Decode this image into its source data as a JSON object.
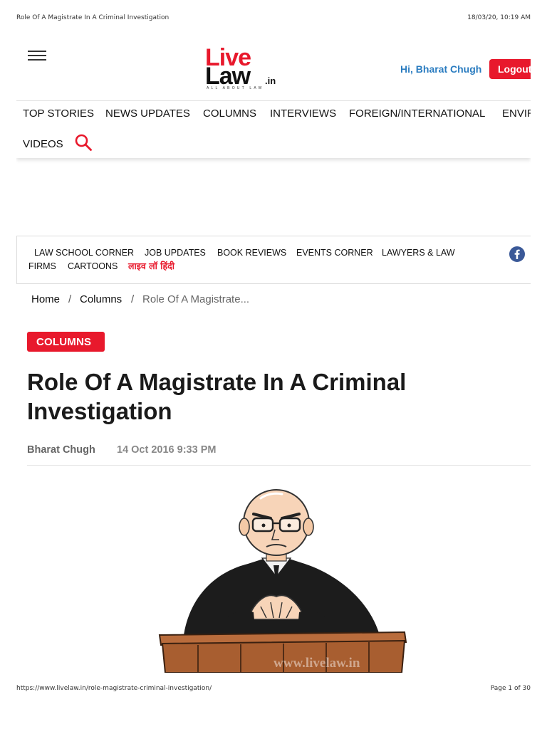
{
  "print": {
    "page_title": "Role Of A Magistrate In A Criminal Investigation",
    "datetime": "18/03/20, 10:19 AM",
    "url": "https://www.livelaw.in/role-magistrate-criminal-investigation/",
    "page_number": "Page 1 of 30"
  },
  "header": {
    "menu_icon": "hamburger-menu-icon",
    "logo": {
      "line1": "Live",
      "line2": "Law",
      "tld": ".in",
      "tagline": "ALL ABOUT LAW"
    },
    "greeting": "Hi, Bharat Chugh",
    "logout_label": "Logout"
  },
  "topnav": {
    "items": [
      "TOP STORIES",
      "NEWS UPDATES",
      "COLUMNS",
      "INTERVIEWS",
      "FOREIGN/INTERNATIONAL",
      "ENVIR",
      "VIDEOS"
    ],
    "search_icon": "search-icon"
  },
  "subnav": {
    "items": [
      "LAW SCHOOL CORNER",
      "JOB UPDATES",
      "BOOK REVIEWS",
      "EVENTS CORNER",
      "LAWYERS & LAW",
      "FIRMS",
      "CARTOONS"
    ],
    "hindi_label": "लाइव लॉ हिंदी",
    "social_icon": "facebook-icon"
  },
  "breadcrumb": {
    "home": "Home",
    "section": "Columns",
    "current": "Role Of A Magistrate...",
    "separator": "/"
  },
  "article": {
    "category": "COLUMNS",
    "title": "Role Of A Magistrate In A Criminal Investigation",
    "author": "Bharat Chugh",
    "date": "14 Oct 2016 9:33 PM",
    "image_watermark": "www.livelaw.in"
  },
  "colors": {
    "brand_red": "#e8192c",
    "link_blue": "#2a7cc0",
    "facebook_blue": "#3b5998"
  }
}
